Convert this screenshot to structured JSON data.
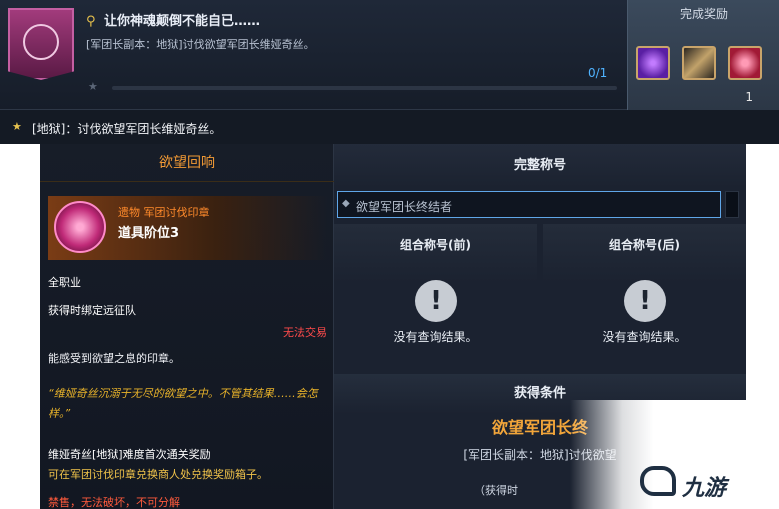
{
  "quest": {
    "title": "让你神魂颠倒不能自已……",
    "description": "[军团长副本：地狱]讨伐欲望军团长维娅奇丝。",
    "progress": "0/1"
  },
  "reward": {
    "title": "完成奖励",
    "count": "1",
    "items": [
      "purple-crystal-icon",
      "scroll-icon",
      "desire-seal-icon"
    ]
  },
  "objective": {
    "text": "[地狱]：讨伐欲望军团长维娅奇丝。"
  },
  "tooltip": {
    "header": "欲望回响",
    "item_type": "遗物 军团讨伐印章",
    "item_name": "道具阶位3",
    "class": "全职业",
    "bind": "获得时绑定远征队",
    "trade": "无法交易",
    "flavor1": "能感受到欲望之息的印章。",
    "quote": "“维娅奇丝沉溺于无尽的欲望之中。不管其结果……会怎样。”",
    "reward_note": "维娅奇丝[地狱]难度首次通关奖励",
    "exchange_note": "可在军团讨伐印章兑换商人处兑换奖励箱子。",
    "restrictions": "禁售，无法破坏，不可分解"
  },
  "titles": {
    "header": "完整称号",
    "input_value": "欲望军团长终结者",
    "combo_front": "组合称号(前)",
    "combo_back": "组合称号(后)",
    "empty": "没有查询结果。",
    "condition_header": "获得条件",
    "condition_title": "欲望军团长终",
    "condition_sub": "[军团长副本：地狱]讨伐欲望",
    "condition_foot": "（获得时"
  },
  "watermark": "九游"
}
